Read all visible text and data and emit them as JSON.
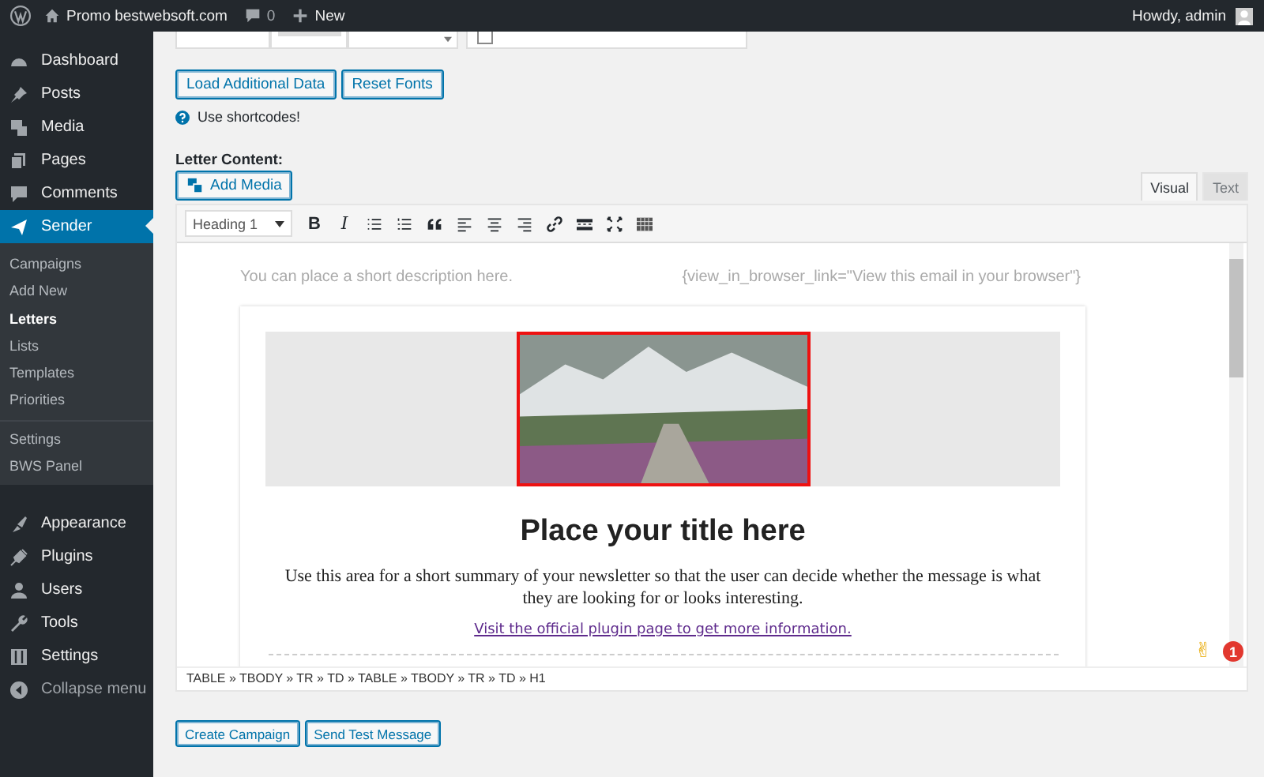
{
  "admin_bar": {
    "site": "Promo bestwebsoft.com",
    "comments": "0",
    "new": "New",
    "greeting": "Howdy, admin"
  },
  "sidebar": {
    "items": [
      {
        "label": "Dashboard",
        "selected": false
      },
      {
        "label": "Posts",
        "selected": false
      },
      {
        "label": "Media",
        "selected": false
      },
      {
        "label": "Pages",
        "selected": false
      },
      {
        "label": "Comments",
        "selected": false
      },
      {
        "label": "Sender",
        "selected": true,
        "children": [
          {
            "label": "Campaigns",
            "selected": false
          },
          {
            "label": "Add New",
            "selected": false
          },
          {
            "label": "Letters",
            "selected": true
          },
          {
            "label": "Lists",
            "selected": false
          },
          {
            "label": "Templates",
            "selected": false
          },
          {
            "label": "Priorities",
            "selected": false
          },
          {
            "label": "Settings",
            "selected": false
          },
          {
            "label": "BWS Panel",
            "selected": false
          }
        ]
      },
      {
        "label": "Appearance",
        "selected": false
      },
      {
        "label": "Plugins",
        "selected": false
      },
      {
        "label": "Users",
        "selected": false
      },
      {
        "label": "Tools",
        "selected": false
      },
      {
        "label": "Settings",
        "selected": false
      }
    ],
    "collapse": "Collapse menu"
  },
  "top_checkbox": {
    "checked": false
  },
  "top_buttons": [
    "Load Additional Data",
    "Reset Fonts"
  ],
  "shortcodes_hint": "Use shortcodes!",
  "letter_content_label": "Letter Content:",
  "add_media": "Add Media",
  "editor_tabs": [
    {
      "label": "Visual",
      "selected": true
    },
    {
      "label": "Text",
      "selected": false
    }
  ],
  "toolbar": {
    "format": "Heading 1",
    "buttons": [
      {
        "kind": "bold",
        "label": "B"
      },
      {
        "kind": "italic",
        "label": "I"
      },
      {
        "kind": "bullets"
      },
      {
        "kind": "numbers"
      },
      {
        "kind": "quote"
      },
      {
        "kind": "align-left"
      },
      {
        "kind": "align-center"
      },
      {
        "kind": "align-right"
      },
      {
        "kind": "link"
      },
      {
        "kind": "more"
      },
      {
        "kind": "fullscreen"
      },
      {
        "kind": "kitchen-sink"
      }
    ]
  },
  "letter": {
    "description": "You can place a short description here.",
    "browser_link": "{view_in_browser_link=\"View this email in your browser\"}",
    "image": {
      "selected": true
    },
    "title": "Place your title here",
    "summary": "Use this area for a short summary of your newsletter so that the user can decide whether the message is what they are looking for or looks interesting.",
    "link": "Visit the official plugin page to get more information."
  },
  "status_path": "TABLE » TBODY » TR » TD » TABLE » TBODY » TR » TD » H1",
  "emoji": "✌",
  "notification_count": "1",
  "bottom_buttons": [
    "Create Campaign",
    "Send Test Message"
  ]
}
